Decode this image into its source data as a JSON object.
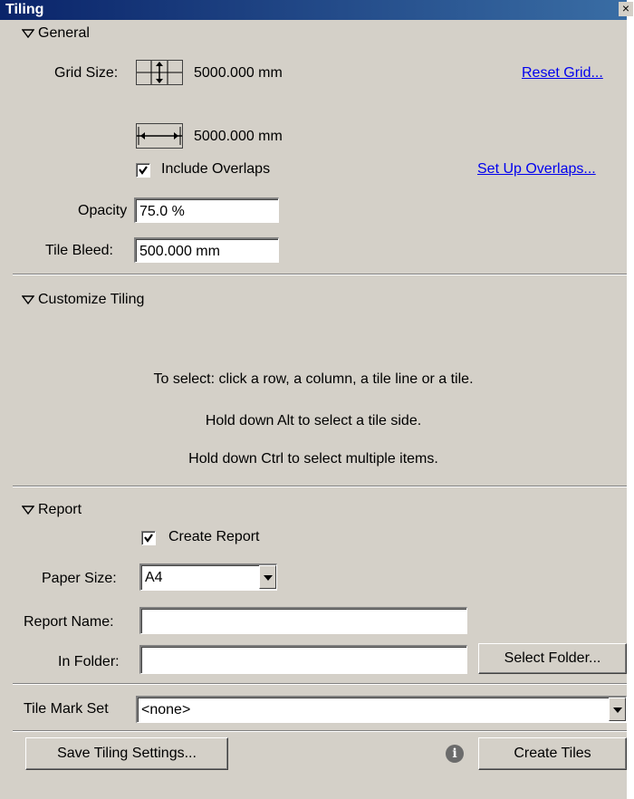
{
  "window": {
    "title": "Tiling",
    "close_glyph": "×"
  },
  "general": {
    "header": "General",
    "grid_size_label": "Grid Size:",
    "grid_height_value": "5000.000 mm",
    "grid_width_value": "5000.000 mm",
    "reset_grid_link": "Reset Grid...",
    "include_overlaps_label": "Include Overlaps",
    "include_overlaps_checked": true,
    "set_up_overlaps_link": "Set Up Overlaps...",
    "opacity_label": "Opacity",
    "opacity_value": "75.0 %",
    "tile_bleed_label": "Tile Bleed:",
    "tile_bleed_value": "500.000 mm"
  },
  "customize": {
    "header": "Customize Tiling",
    "hint_1": "To select: click a row, a column, a tile line or a tile.",
    "hint_2": "Hold down Alt to select a tile side.",
    "hint_3": "Hold down Ctrl to select multiple items."
  },
  "report": {
    "header": "Report",
    "create_report_label": "Create Report",
    "create_report_checked": true,
    "paper_size_label": "Paper Size:",
    "paper_size_value": "A4",
    "report_name_label": "Report Name:",
    "report_name_value": "",
    "in_folder_label": "In Folder:",
    "in_folder_value": "",
    "select_folder_button": "Select Folder..."
  },
  "tile_mark_set": {
    "label": "Tile Mark Set",
    "value": "<none>"
  },
  "footer": {
    "save_settings_button": "Save Tiling Settings...",
    "info_glyph": "i",
    "create_tiles_button": "Create Tiles"
  },
  "icons": {
    "section_toggle": "triangle-down-icon",
    "grid_height": "grid-height-icon",
    "grid_width": "grid-width-icon",
    "dropdown": "chevron-down-icon",
    "info": "info-icon"
  }
}
